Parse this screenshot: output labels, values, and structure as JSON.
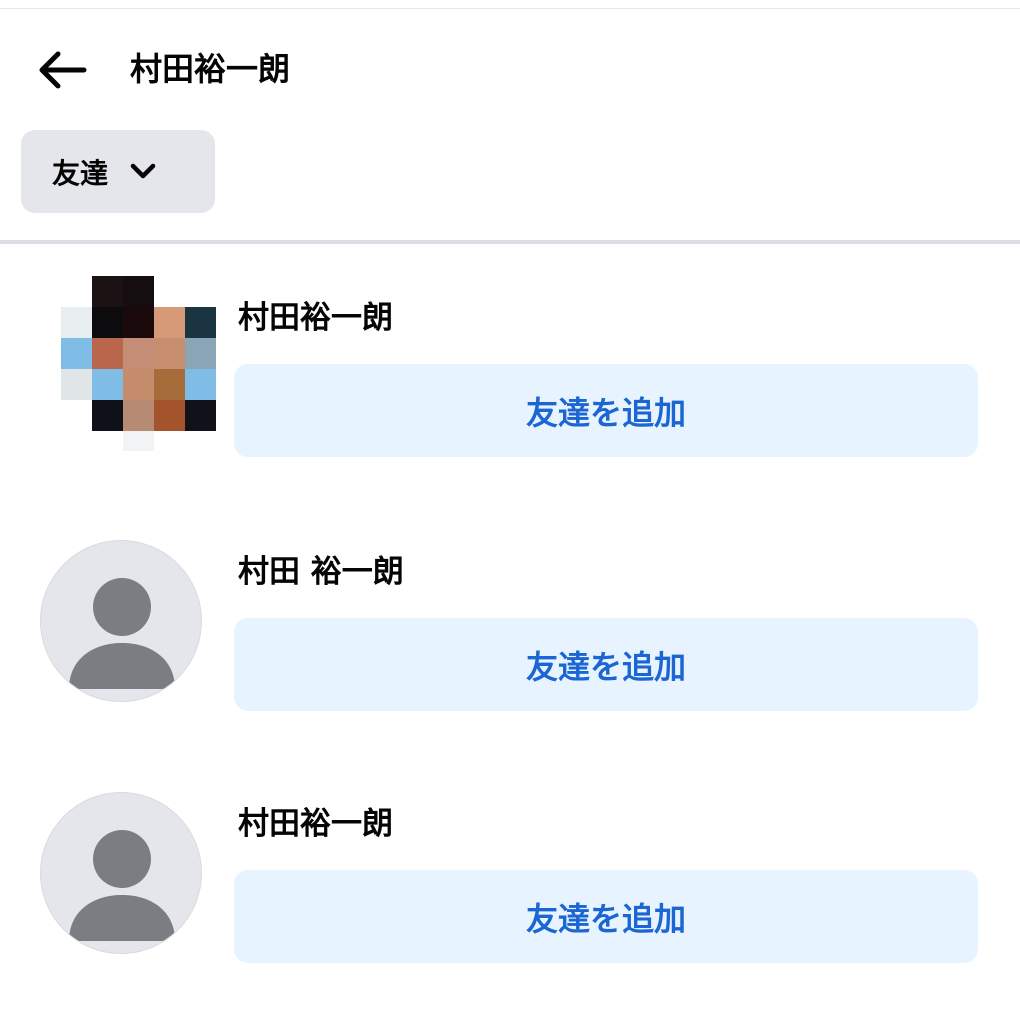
{
  "header": {
    "back_icon": "arrow-left-icon",
    "title": "村田裕一朗"
  },
  "filter": {
    "label": "友達",
    "icon": "chevron-down-icon"
  },
  "results": [
    {
      "name": "村田裕一朗",
      "avatar": "pixelated-photo",
      "button_label": "友達を追加"
    },
    {
      "name": "村田 裕一朗",
      "avatar": "default-profile-icon",
      "button_label": "友達を追加"
    },
    {
      "name": "村田裕一朗",
      "avatar": "default-profile-icon",
      "button_label": "友達を追加"
    }
  ],
  "colors": {
    "accent_text": "#1b66d2",
    "button_bg": "#e7f3ff",
    "chip_bg": "#e4e6eb",
    "avatar_bg": "#e4e6eb",
    "avatar_silhouette": "#7a7d82"
  }
}
